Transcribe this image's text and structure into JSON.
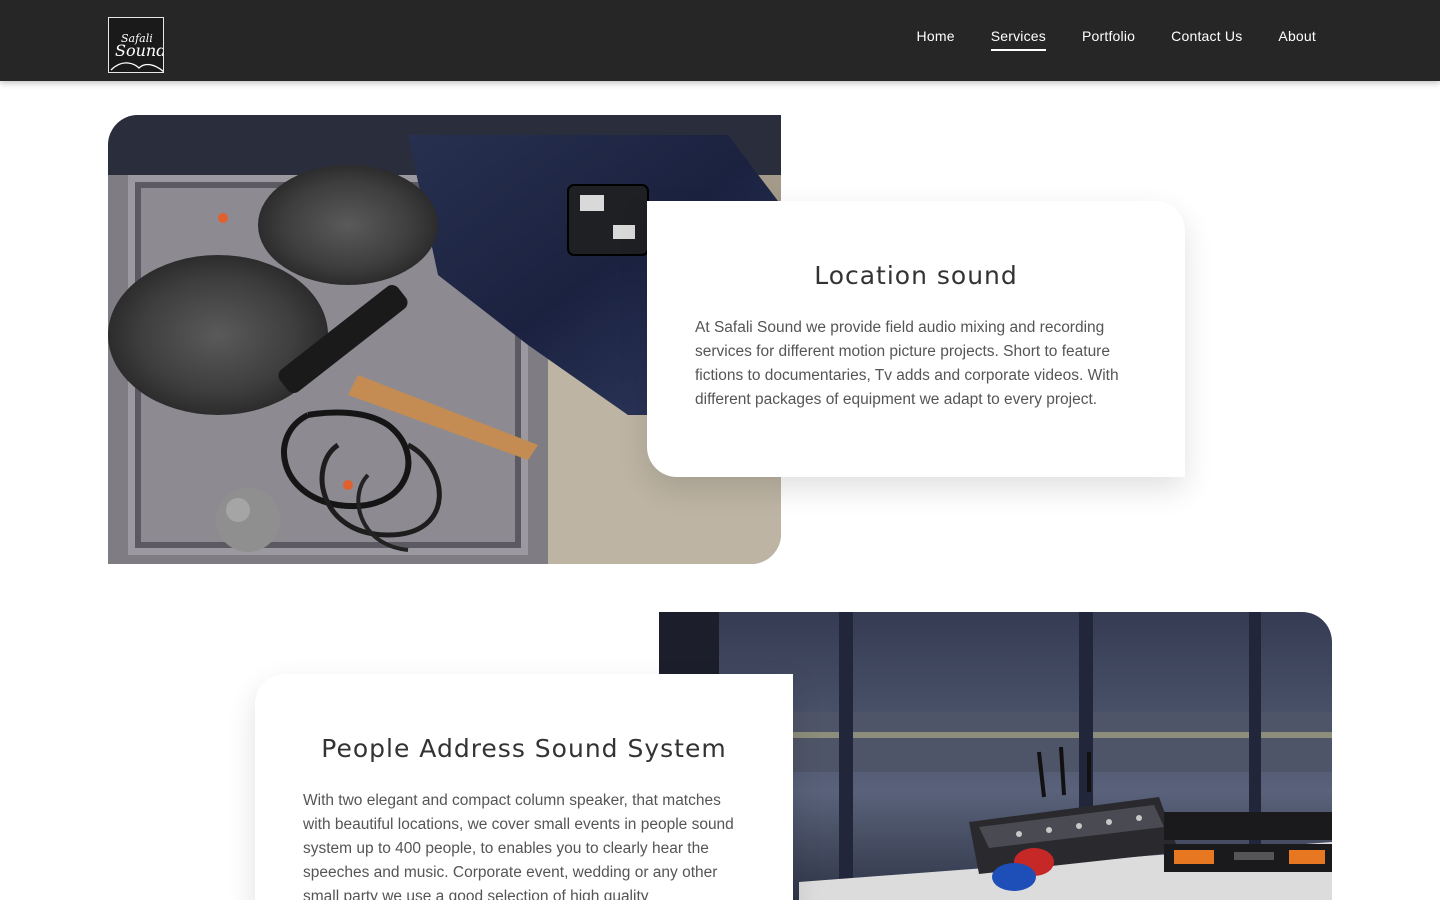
{
  "logo": {
    "text_top": "Safali",
    "text_bottom": "Sound"
  },
  "nav": {
    "items": [
      {
        "label": "Home",
        "active": false
      },
      {
        "label": "Services",
        "active": true
      },
      {
        "label": "Portfolio",
        "active": false
      },
      {
        "label": "Contact Us",
        "active": false
      },
      {
        "label": "About",
        "active": false
      }
    ]
  },
  "services": [
    {
      "title": "Location sound",
      "description": "At Safali Sound we provide field audio mixing and recording services for different motion picture projects. Short to feature fictions to documentaries, Tv adds and corporate videos. With different packages of equipment we adapt to every project.",
      "image": "location-sound-equipment-photo"
    },
    {
      "title": "People Address Sound System",
      "description": "With two elegant and compact column speaker, that matches with beautiful locations, we cover small events in people sound system up to 400 people, to enables you to clearly hear the speeches and music. Corporate event, wedding or any other small party we use a good selection of high quality",
      "image": "audio-mixer-photo"
    }
  ],
  "colors": {
    "header_bg": "#262626",
    "nav_text": "#ffffff",
    "card_bg": "#ffffff"
  }
}
